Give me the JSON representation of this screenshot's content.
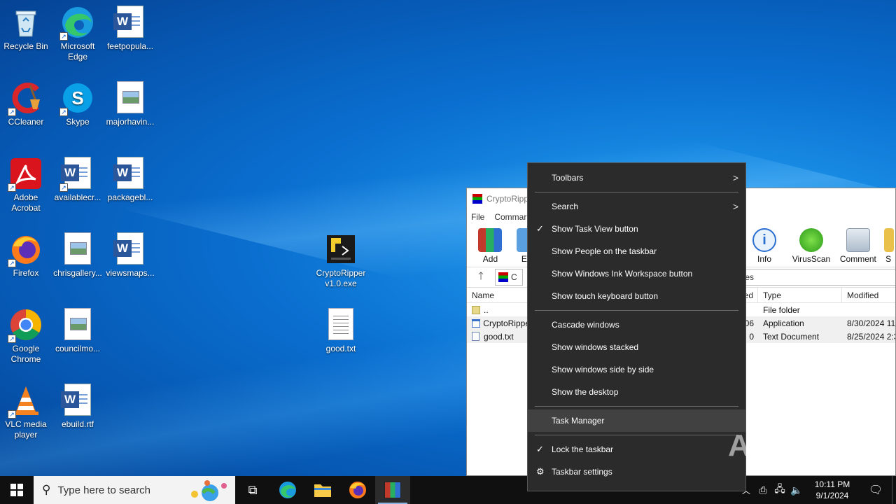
{
  "desktop": {
    "icons": [
      {
        "label": "Recycle Bin",
        "icon": "recycle-bin-icon"
      },
      {
        "label": "Microsoft Edge",
        "icon": "edge-icon"
      },
      {
        "label": "feetpopula...",
        "icon": "word-doc-icon"
      },
      {
        "label": "CCleaner",
        "icon": "ccleaner-icon"
      },
      {
        "label": "Skype",
        "icon": "skype-icon"
      },
      {
        "label": "majorhavin...",
        "icon": "image-doc-icon"
      },
      {
        "label": "Adobe Acrobat",
        "icon": "acrobat-icon"
      },
      {
        "label": "availablecr...",
        "icon": "word-doc-icon"
      },
      {
        "label": "packagebl...",
        "icon": "word-doc-icon"
      },
      {
        "label": "Firefox",
        "icon": "firefox-icon"
      },
      {
        "label": "chrisgallery...",
        "icon": "image-doc-icon"
      },
      {
        "label": "viewsmaps...",
        "icon": "word-doc-icon"
      },
      {
        "label": "Google Chrome",
        "icon": "chrome-icon"
      },
      {
        "label": "councilmo...",
        "icon": "image-doc-icon"
      },
      {
        "label": "VLC media player",
        "icon": "vlc-icon"
      },
      {
        "label": "ebuild.rtf",
        "icon": "word-doc-icon"
      },
      {
        "label": "CryptoRipper v1.0.exe",
        "icon": "python-exe-icon"
      },
      {
        "label": "good.txt",
        "icon": "text-file-icon"
      }
    ]
  },
  "winrar": {
    "title": "CryptoRipp",
    "menu": [
      "File",
      "Commar"
    ],
    "toolbar": [
      "Add",
      "Ext",
      "Info",
      "VirusScan",
      "Comment",
      "S"
    ],
    "path_label": "C",
    "size_suffix": "ytes",
    "columns": [
      "Name",
      "ed",
      "Type",
      "Modified"
    ],
    "rows": [
      {
        "name": "..",
        "size": "",
        "type": "File folder",
        "modified": ""
      },
      {
        "name": "CryptoRippe",
        "size": "06",
        "type": "Application",
        "modified": "8/30/2024 11:"
      },
      {
        "name": "good.txt",
        "size": "0",
        "type": "Text Document",
        "modified": "8/25/2024 2:3"
      }
    ]
  },
  "context_menu": {
    "items": [
      {
        "label": "Toolbars",
        "submenu": true
      },
      {
        "sep": true
      },
      {
        "label": "Search",
        "submenu": true
      },
      {
        "label": "Show Task View button",
        "checked": true
      },
      {
        "label": "Show People on the taskbar"
      },
      {
        "label": "Show Windows Ink Workspace button"
      },
      {
        "label": "Show touch keyboard button"
      },
      {
        "sep": true
      },
      {
        "label": "Cascade windows"
      },
      {
        "label": "Show windows stacked"
      },
      {
        "label": "Show windows side by side"
      },
      {
        "label": "Show the desktop"
      },
      {
        "sep": true
      },
      {
        "label": "Task Manager",
        "hover": true
      },
      {
        "sep": true
      },
      {
        "label": "Lock the taskbar",
        "checked": true
      },
      {
        "label": "Taskbar settings",
        "gear": true
      }
    ]
  },
  "taskbar": {
    "search_placeholder": "Type here to search",
    "time": "10:11 PM",
    "date": "9/1/2024"
  },
  "watermark": "ANY RUN"
}
